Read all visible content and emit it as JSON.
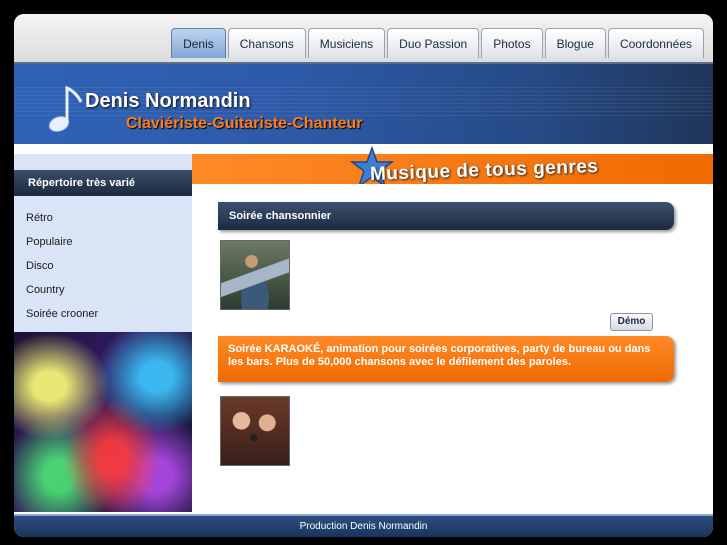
{
  "nav": {
    "tabs": [
      {
        "label": "Denis",
        "active": true
      },
      {
        "label": "Chansons"
      },
      {
        "label": "Musiciens"
      },
      {
        "label": "Duo Passion"
      },
      {
        "label": "Photos"
      },
      {
        "label": "Blogue"
      },
      {
        "label": "Coordonnées"
      }
    ]
  },
  "header": {
    "title": "Denis Normandin",
    "subtitle": "Claviériste-Guitariste-Chanteur",
    "icon": "music-note-icon"
  },
  "slogan": "Musique de tous genres",
  "sidebar": {
    "heading": "Répertoire très varié",
    "items": [
      "Rétro",
      "Populaire",
      "Disco",
      "Country",
      "Soirée crooner"
    ]
  },
  "main": {
    "section1_title": "Soirée chansonnier",
    "demo_label": "Démo",
    "section2_text": "Soirée KARAOKÉ, animation pour soirées corporatives, party de bureau ou dans les bars. Plus de 50,000 chansons avec le défilement des paroles."
  },
  "footer": {
    "text": "Production Denis Normandin"
  },
  "colors": {
    "accent_orange": "#f06a00",
    "header_blue": "#2d5aa8",
    "dark_navy": "#1c2a42",
    "sidebar_bg": "#d9e4f7"
  }
}
